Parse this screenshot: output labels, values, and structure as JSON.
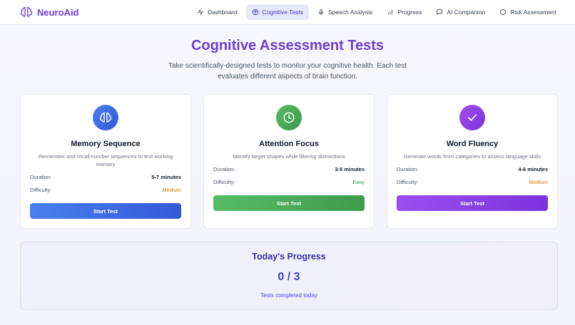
{
  "brand": {
    "name": "NeuroAid",
    "icon": "brain-icon",
    "color": "#6d3fd6"
  },
  "nav": {
    "items": [
      {
        "label": "Dashboard",
        "icon": "activity-icon",
        "active": false
      },
      {
        "label": "Cognitive Tests",
        "icon": "brain-icon",
        "active": true
      },
      {
        "label": "Speech Analysis",
        "icon": "microphone-icon",
        "active": false
      },
      {
        "label": "Progress",
        "icon": "bar-chart-icon",
        "active": false
      },
      {
        "label": "AI Companion",
        "icon": "chat-bubble-icon",
        "active": false
      },
      {
        "label": "Risk Assessment",
        "icon": "shield-icon",
        "active": false
      }
    ]
  },
  "hero": {
    "title": "Cognitive Assessment Tests",
    "subtitle": "Take scientifically-designed tests to monitor your cognitive health. Each test evaluates different aspects of brain function."
  },
  "labels": {
    "duration": "Duration:",
    "difficulty": "Difficulty:"
  },
  "tests": [
    {
      "title": "Memory Sequence",
      "description": "Remember and recall number sequences to test working memory",
      "duration": "5-7 minutes",
      "difficulty": "Medium",
      "button": "Start Test",
      "icon": "brain-icon",
      "color": "#3b6fe0"
    },
    {
      "title": "Attention Focus",
      "description": "Identify target shapes while filtering distractions",
      "duration": "3-5 minutes",
      "difficulty": "Easy",
      "button": "Start Test",
      "icon": "clock-icon",
      "color": "#43a452"
    },
    {
      "title": "Word Fluency",
      "description": "Generate words from categories to assess language skills",
      "duration": "4-6 minutes",
      "difficulty": "Medium",
      "button": "Start Test",
      "icon": "check-icon",
      "color": "#8b3fe0"
    }
  ],
  "progress": {
    "title": "Today's Progress",
    "count": "0 / 3",
    "label": "Tests completed today"
  }
}
